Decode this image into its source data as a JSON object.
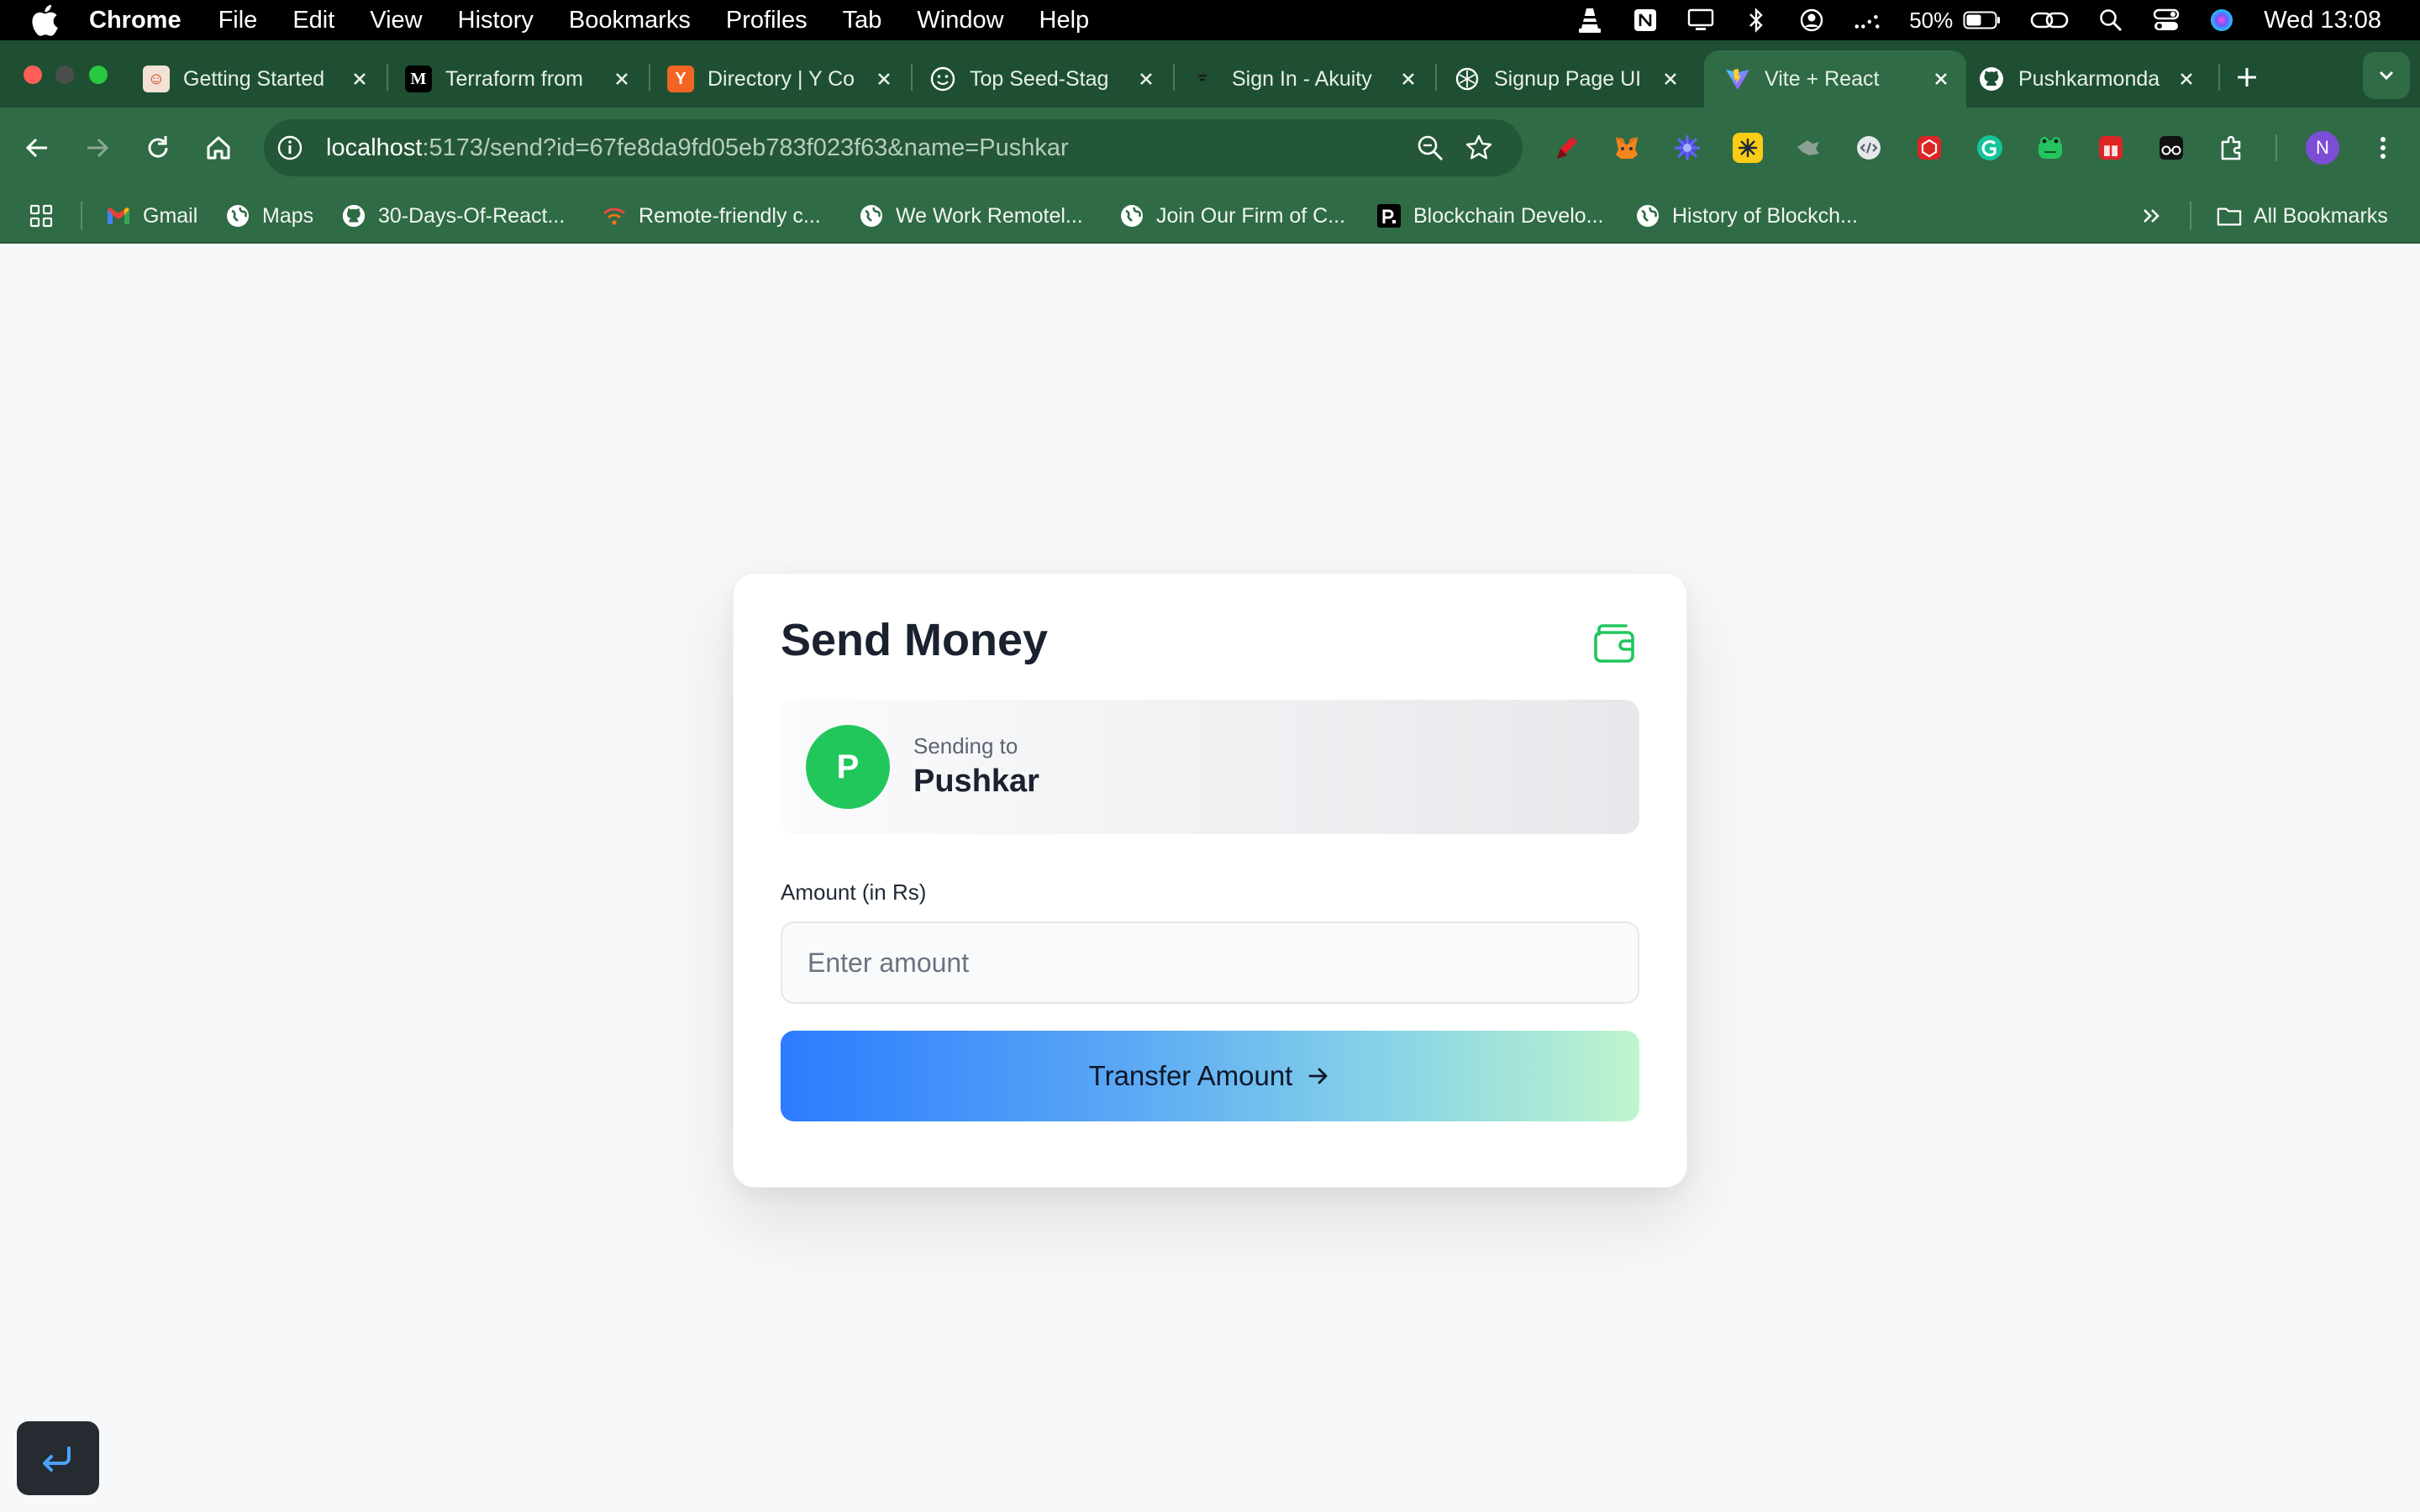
{
  "menubar": {
    "app_name": "Chrome",
    "menus": [
      "File",
      "Edit",
      "View",
      "History",
      "Bookmarks",
      "Profiles",
      "Tab",
      "Window",
      "Help"
    ],
    "battery_percent": "50%",
    "clock": "Wed 13:08"
  },
  "tabs": [
    {
      "title": "Getting Started",
      "favicon": "gitlab-style-icon",
      "active": false
    },
    {
      "title": "Terraform from",
      "favicon": "medium-icon",
      "active": false
    },
    {
      "title": "Directory | Y Co",
      "favicon": "ycombinator-icon",
      "active": false
    },
    {
      "title": "Top Seed-Stag",
      "favicon": "smiley-icon",
      "active": false
    },
    {
      "title": "Sign In - Akuity",
      "favicon": "akuity-icon",
      "active": false
    },
    {
      "title": "Signup Page UI",
      "favicon": "openai-icon",
      "active": false
    },
    {
      "title": "Vite + React",
      "favicon": "vite-icon",
      "active": true
    },
    {
      "title": "Pushkarmonda",
      "favicon": "github-icon",
      "active": false
    }
  ],
  "toolbar": {
    "url_host": "localhost",
    "url_rest": ":5173/send?id=67fe8da9fd05eb783f023f63&name=Pushkar",
    "profile_initial": "N"
  },
  "bookmarks": {
    "items": [
      {
        "label": "Gmail",
        "icon": "gmail-icon"
      },
      {
        "label": "Maps",
        "icon": "globe-icon"
      },
      {
        "label": "30-Days-Of-React...",
        "icon": "github-icon"
      },
      {
        "label": "Remote-friendly c...",
        "icon": "wifi-icon"
      },
      {
        "label": "We Work Remotel...",
        "icon": "globe-icon"
      },
      {
        "label": "Join Our Firm of C...",
        "icon": "globe-icon"
      },
      {
        "label": "Blockchain Develo...",
        "icon": "r-logo-icon"
      },
      {
        "label": "History of Blockch...",
        "icon": "globe-icon"
      }
    ],
    "all_bookmarks": "All Bookmarks"
  },
  "card": {
    "title": "Send Money",
    "sending_to_label": "Sending to",
    "recipient_name": "Pushkar",
    "recipient_initial": "P",
    "amount_label": "Amount (in Rs)",
    "amount_value": "",
    "amount_placeholder": "Enter amount",
    "transfer_button": "Transfer Amount"
  },
  "colors": {
    "accent_green": "#22c75c",
    "browser_frame": "#2f6b45",
    "button_gradient_start": "#2b7bff",
    "button_gradient_end": "#bff5cc"
  }
}
